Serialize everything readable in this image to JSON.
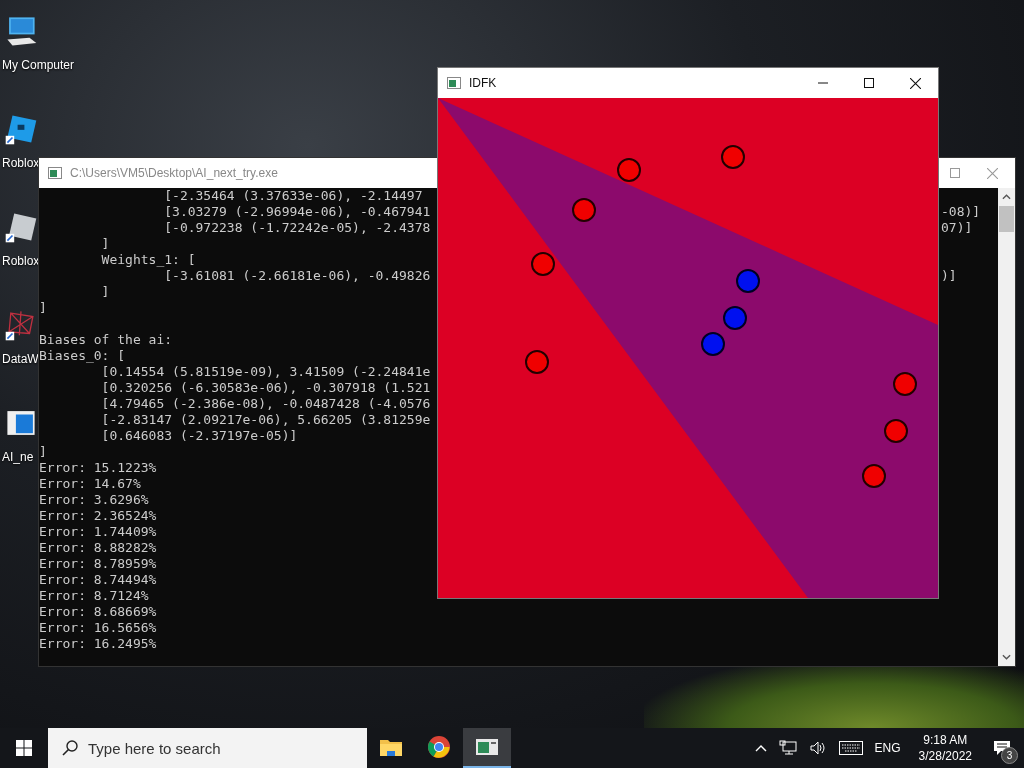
{
  "desktop": {
    "icons": [
      {
        "kind": "computer",
        "label": "My Computer"
      },
      {
        "kind": "blue-tile",
        "label": "Roblox"
      },
      {
        "kind": "gray-tile",
        "label": "Roblox"
      },
      {
        "kind": "red-mesh",
        "label": "DataW"
      },
      {
        "kind": "window",
        "label": "AI_ne"
      }
    ]
  },
  "console_window": {
    "title": "C:\\Users\\VM5\\Desktop\\AI_next_try.exe",
    "sections": [
      {
        "lines": [
          {
            "text": "                [-2.35464 (3.37633e-06), -2.14497"
          },
          {
            "text": "                [3.03279 (-2.96994e-06), -0.467941",
            "tail": "-08)]"
          },
          {
            "text": "                [-0.972238 (-1.72242e-05), -2.4378",
            "tail": "07)]"
          },
          {
            "text": "        ]"
          },
          {
            "text": "        Weights_1: ["
          },
          {
            "text": "                [-3.61081 (-2.66181e-06), -0.49826",
            "tail": ")]"
          },
          {
            "text": "        ]"
          },
          {
            "text": "]"
          }
        ]
      },
      {
        "lines": [
          {
            "text": "Biases of the ai:"
          },
          {
            "text": "Biases_0: ["
          },
          {
            "text": "        [0.14554 (5.81519e-09), 3.41509 (-2.24841e"
          },
          {
            "text": "        [0.320256 (-6.30583e-06), -0.307918 (1.521"
          },
          {
            "text": "        [4.79465 (-2.386e-08), -0.0487428 (-4.0576"
          },
          {
            "text": "        [-2.83147 (2.09217e-06), 5.66205 (3.81259e"
          },
          {
            "text": "        [0.646083 (-2.37197e-05)]"
          },
          {
            "text": "]"
          },
          {
            "text": "Error: 15.1223%"
          },
          {
            "text": "Error: 14.67%"
          },
          {
            "text": "Error: 3.6296%"
          },
          {
            "text": "Error: 2.36524%"
          },
          {
            "text": "Error: 1.74409%"
          },
          {
            "text": "Error: 8.88282%"
          },
          {
            "text": "Error: 8.78959%"
          },
          {
            "text": "Error: 8.74494%"
          },
          {
            "text": "Error: 8.7124%"
          },
          {
            "text": "Error: 8.68669%"
          },
          {
            "text": "Error: 16.5656%"
          },
          {
            "text": "Error: 16.2495%"
          }
        ]
      }
    ]
  },
  "plot_window": {
    "title": "IDFK"
  },
  "taskbar": {
    "search": {
      "placeholder": "Type here to search"
    },
    "apps": [
      {
        "kind": "folder",
        "selected": false
      },
      {
        "kind": "browser",
        "selected": false
      },
      {
        "kind": "console",
        "selected": true
      }
    ],
    "tray": {
      "language": "ENG",
      "time": "9:18 AM",
      "date": "3/28/2022",
      "notification_count": "3"
    }
  }
}
